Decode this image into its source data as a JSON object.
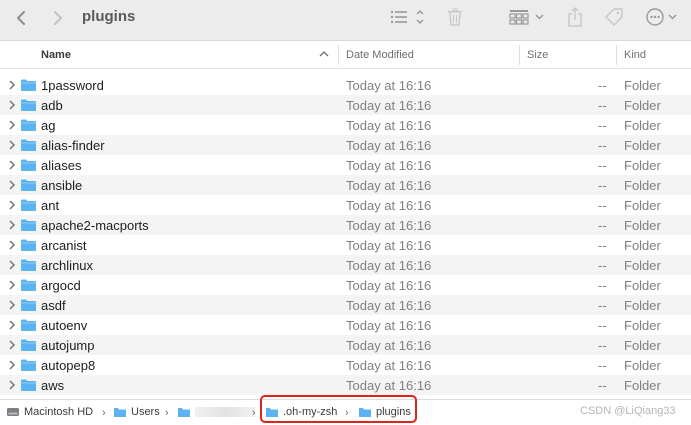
{
  "toolbar": {
    "title": "plugins",
    "back_icon": "chevron-left-icon",
    "forward_icon": "chevron-right-icon"
  },
  "columns": {
    "name": "Name",
    "date": "Date Modified",
    "size": "Size",
    "kind": "Kind"
  },
  "rows": [
    {
      "name": "1password",
      "date": "Today at 16:16",
      "size": "--",
      "kind": "Folder"
    },
    {
      "name": "adb",
      "date": "Today at 16:16",
      "size": "--",
      "kind": "Folder"
    },
    {
      "name": "ag",
      "date": "Today at 16:16",
      "size": "--",
      "kind": "Folder"
    },
    {
      "name": "alias-finder",
      "date": "Today at 16:16",
      "size": "--",
      "kind": "Folder"
    },
    {
      "name": "aliases",
      "date": "Today at 16:16",
      "size": "--",
      "kind": "Folder"
    },
    {
      "name": "ansible",
      "date": "Today at 16:16",
      "size": "--",
      "kind": "Folder"
    },
    {
      "name": "ant",
      "date": "Today at 16:16",
      "size": "--",
      "kind": "Folder"
    },
    {
      "name": "apache2-macports",
      "date": "Today at 16:16",
      "size": "--",
      "kind": "Folder"
    },
    {
      "name": "arcanist",
      "date": "Today at 16:16",
      "size": "--",
      "kind": "Folder"
    },
    {
      "name": "archlinux",
      "date": "Today at 16:16",
      "size": "--",
      "kind": "Folder"
    },
    {
      "name": "argocd",
      "date": "Today at 16:16",
      "size": "--",
      "kind": "Folder"
    },
    {
      "name": "asdf",
      "date": "Today at 16:16",
      "size": "--",
      "kind": "Folder"
    },
    {
      "name": "autoenv",
      "date": "Today at 16:16",
      "size": "--",
      "kind": "Folder"
    },
    {
      "name": "autojump",
      "date": "Today at 16:16",
      "size": "--",
      "kind": "Folder"
    },
    {
      "name": "autopep8",
      "date": "Today at 16:16",
      "size": "--",
      "kind": "Folder"
    },
    {
      "name": "aws",
      "date": "Today at 16:16",
      "size": "--",
      "kind": "Folder"
    }
  ],
  "pathbar": {
    "disk": "Macintosh HD",
    "users": "Users",
    "ohmyzsh": ".oh-my-zsh",
    "plugins": "plugins"
  },
  "watermark": "CSDN @LiQiang33",
  "colors": {
    "folder": "#5cb3f2",
    "highlight": "#e0241b",
    "alt_row": "#f4f4f5"
  }
}
